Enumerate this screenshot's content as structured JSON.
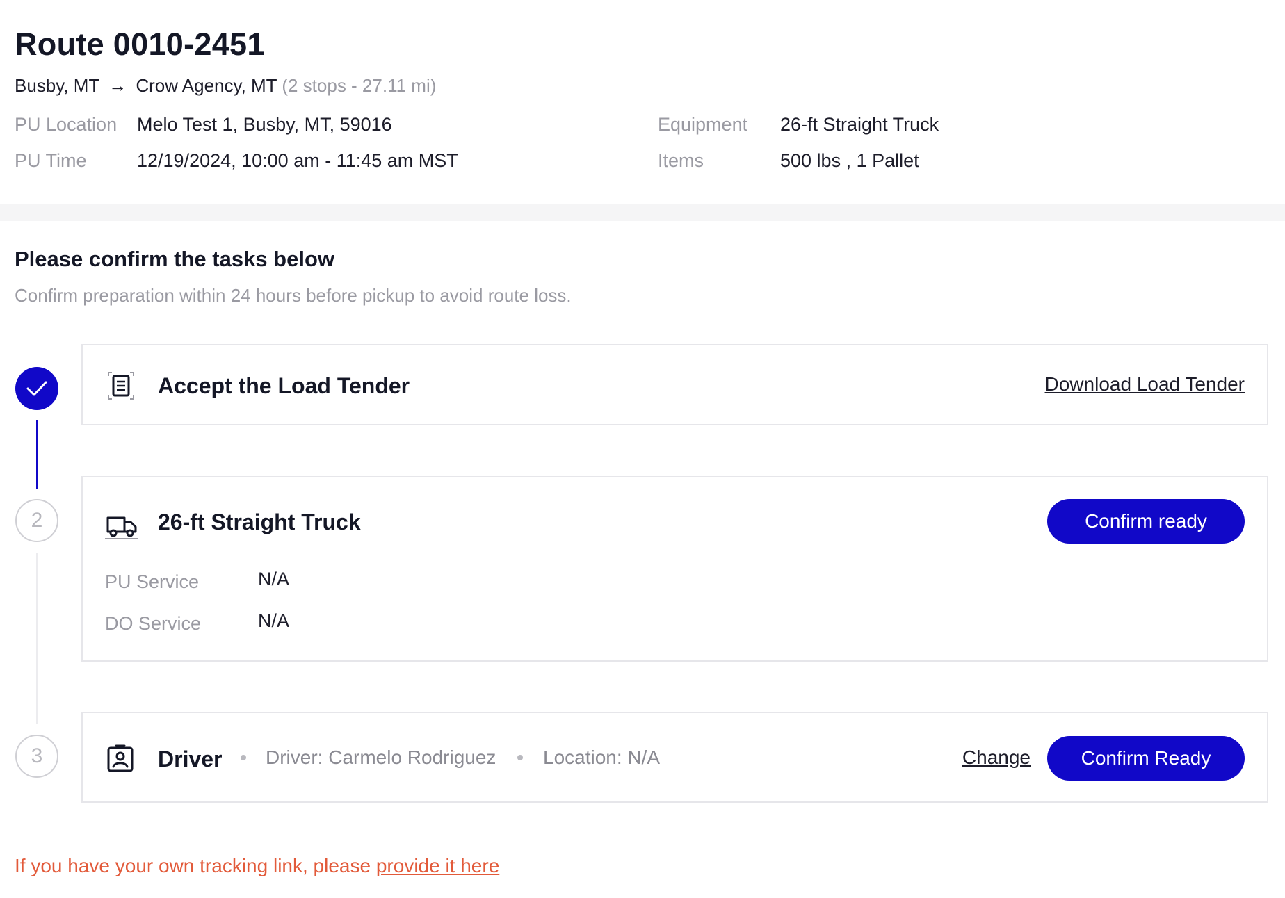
{
  "route": {
    "title": "Route 0010-2451",
    "origin": "Busby, MT",
    "arrow": "→",
    "destination": "Crow Agency, MT",
    "summary": "(2 stops - 27.11 mi)"
  },
  "info": {
    "pu_location_label": "PU Location",
    "pu_location_value": "Melo Test 1, Busby, MT, 59016",
    "pu_time_label": "PU Time",
    "pu_time_value": "12/19/2024, 10:00 am - 11:45 am MST",
    "equipment_label": "Equipment",
    "equipment_value": "26-ft Straight Truck",
    "items_label": "Items",
    "items_value": "500 lbs , 1 Pallet"
  },
  "tasks": {
    "title": "Please confirm the tasks below",
    "description": "Confirm preparation within 24 hours before pickup to avoid route loss.",
    "steps": [
      {
        "status": "done",
        "title": "Accept the Load Tender",
        "action_link": "Download Load Tender",
        "icon": "document-icon"
      },
      {
        "status": "pending",
        "number": "2",
        "title": "26-ft Straight Truck",
        "button": "Confirm ready",
        "icon": "truck-icon",
        "pu_service_label": "PU Service",
        "pu_service_value": "N/A",
        "do_service_label": "DO Service",
        "do_service_value": "N/A"
      },
      {
        "status": "pending",
        "number": "3",
        "title": "Driver",
        "driver": "Driver: Carmelo Rodriguez",
        "location": "Location: N/A",
        "change_link": "Change",
        "button": "Confirm Ready",
        "icon": "driver-badge-icon"
      }
    ]
  },
  "tracking": {
    "text": "If you have your own tracking link, please ",
    "link": "provide it here"
  },
  "colors": {
    "primary": "#1108c8",
    "muted": "#9a9aa2",
    "warning": "#e25a3a",
    "border": "#e6e6ea"
  }
}
